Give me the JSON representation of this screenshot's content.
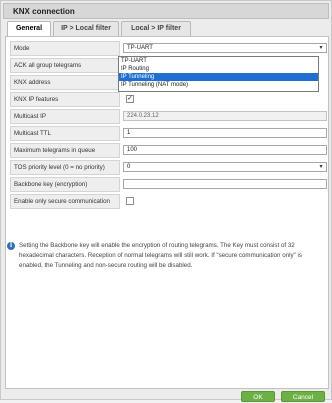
{
  "window": {
    "title": "KNX connection"
  },
  "tabs": [
    {
      "label": "General"
    },
    {
      "label": "IP > Local filter"
    },
    {
      "label": "Local > IP filter"
    }
  ],
  "form": {
    "mode": {
      "label": "Mode",
      "value": "TP-UART"
    },
    "ack": {
      "label": "ACK all group telegrams"
    },
    "knx_address": {
      "label": "KNX address"
    },
    "knx_ip_features": {
      "label": "KNX IP features",
      "checked": "✓"
    },
    "multicast_ip": {
      "label": "Multicast IP",
      "value": "224.0.23.12"
    },
    "multicast_ttl": {
      "label": "Multicast TTL",
      "value": "1"
    },
    "max_queue": {
      "label": "Maximum telegrams in queue",
      "value": "100"
    },
    "tos": {
      "label": "TOS priority level (0 = no priority)",
      "value": "0"
    },
    "backbone_key": {
      "label": "Backbone key (encryption)",
      "value": ""
    },
    "secure_only": {
      "label": "Enable only secure communication"
    }
  },
  "mode_dropdown": {
    "options": [
      "TP-UART",
      "IP Routing",
      "IP Tunneling",
      "IP Tunneling (NAT mode)"
    ],
    "selected": "IP Tunneling"
  },
  "info": {
    "icon": "info-icon",
    "text": "Setting the Backbone key will enable the encryption of routing telegrams. The Key must consist of 32 hexadecimal characters. Reception of normal telegrams will still work. If \"secure communication only\" is enabled, the Tunneling and non-secure routing will be disabled."
  },
  "buttons": {
    "ok": "OK",
    "cancel": "Cancel"
  },
  "colors": {
    "accent": "#6db146",
    "selection": "#1f6fd1"
  }
}
